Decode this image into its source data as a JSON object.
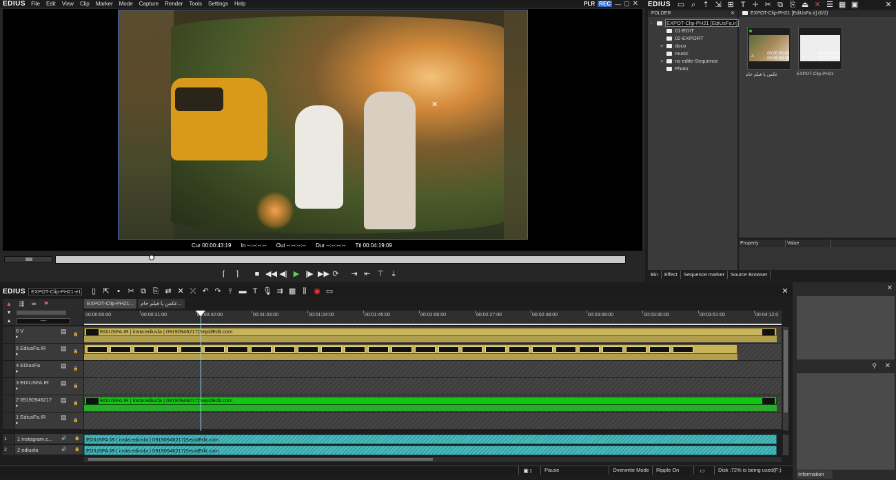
{
  "app": {
    "name": "EDIUS"
  },
  "menu": [
    "File",
    "Edit",
    "View",
    "Clip",
    "Marker",
    "Mode",
    "Capture",
    "Render",
    "Tools",
    "Settings",
    "Help"
  ],
  "player": {
    "plr_label": "PLR",
    "rec_label": "REC",
    "cur_label": "Cur",
    "cur_value": "00:00:43:19",
    "in_label": "In",
    "in_value": "--:--:--:--",
    "out_label": "Out",
    "out_value": "--:--:--:--",
    "dur_label": "Dur",
    "dur_value": "--:--:--:--",
    "ttl_label": "Ttl",
    "ttl_value": "00:04:19:09",
    "scrub_progress": 0.168
  },
  "bin": {
    "app_name": "EDIUS",
    "folder_header": "FOLDER",
    "folder_tree": [
      {
        "label": "EXPOT-Clip-PH21 [EdiUsFa.ir]",
        "level": 0,
        "expander": "-",
        "selected": true
      },
      {
        "label": "01-EDIT",
        "level": 1,
        "expander": ""
      },
      {
        "label": "02-EXPORT",
        "level": 1,
        "expander": ""
      },
      {
        "label": "doco",
        "level": 1,
        "expander": "+"
      },
      {
        "label": "music",
        "level": 1,
        "expander": ""
      },
      {
        "label": "no edite-Sequence",
        "level": 1,
        "expander": "+"
      },
      {
        "label": "Photo",
        "level": 1,
        "expander": ""
      }
    ],
    "clips_header": "EXPOT-Clip-PH21 [EdiUsFa.ir] (0/2)",
    "clips": [
      {
        "name": "عکس یا فیلم خام",
        "tc_in": "00:00:00:00",
        "tc_out": "00:06:09:15"
      },
      {
        "name": "EXPOT-Clip-PH21",
        "tc_in": "00:00:00:00",
        "tc_out": "00:04:19:09"
      }
    ],
    "property_col": "Property",
    "value_col": "Value",
    "tabs": [
      "Bin",
      "Effect",
      "Sequence marker",
      "Source Browser"
    ]
  },
  "timeline": {
    "app_name": "EDIUS",
    "project_name": "EXPOT-Clip-PH21-e1",
    "sequence_tabs": [
      "EXPOT-Clip-PH21...",
      "عکس یا فیلم خام..."
    ],
    "ruler_start": "00:00:00:00",
    "ruler_marks": [
      "00:00:21:00",
      "00:00:42:00",
      "00:01:03:00",
      "00:01:24:00",
      "00:01:45:00",
      "00:02:06:00",
      "00:02:27:00",
      "00:02:48:00",
      "00:03:09:00",
      "00:03:30:00",
      "00:03:51:00",
      "00:04:12:0"
    ],
    "dropdown_value": "----",
    "tracks": [
      {
        "label": "6 V",
        "clip_text": "EDIUSFA.IR  |  insta:ediusfa  |   09190946217|SepidEdit.com"
      },
      {
        "label": "5 EdiusFa.IR",
        "clip_text": ""
      },
      {
        "label": "4 EDiusFa",
        "clip_text": ""
      },
      {
        "label": "3 EDIUSFA.IR",
        "clip_text": ""
      },
      {
        "label": "2 09190946217",
        "clip_text": "EDIUSFA.IR  |  insta:ediusfa  |   09190946217|SepidEdit.com"
      },
      {
        "label": "1 EdiusFa.IR",
        "clip_text": ""
      }
    ],
    "audio_tracks": [
      {
        "num": "1",
        "label": "1 instagram.c...",
        "clip_text": "EDIUSFA.IR  |  insta:ediusfa  |   09190946217|SepidEdit.com"
      },
      {
        "num": "2",
        "label": "2 ediusfa",
        "clip_text": "EDIUSFA.IR  |  insta:ediusfa  |   09190946217|SepidEdit.com"
      }
    ]
  },
  "status": {
    "count": "1",
    "state": "Pause",
    "mode": "Overwrite Mode",
    "ripple": "Ripple On",
    "disk": "Disk :72% is being used(F:)"
  },
  "info_panel": {
    "tab": "Information"
  },
  "colors": {
    "accent_blue": "#2f66c8",
    "clip_yellow": "#c8b45a",
    "clip_green": "#12c612",
    "clip_cyan": "#45bcc0"
  }
}
